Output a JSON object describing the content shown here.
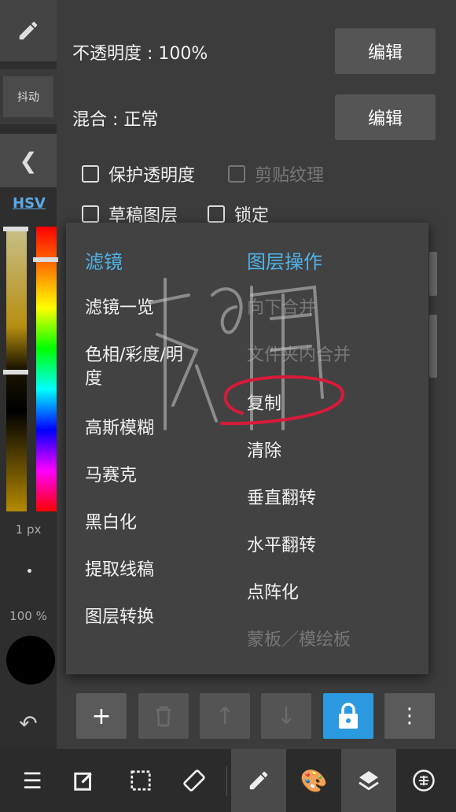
{
  "layer_properties": {
    "opacity_label": "不透明度 : 100%",
    "blend_label": "混合 : 正常",
    "edit_label": "编辑",
    "protect_alpha": "保护透明度",
    "clipping": "剪贴纹理",
    "draft_layer": "草稿图层",
    "lock": "锁定"
  },
  "left_panel": {
    "brush_tab": "抖动",
    "color_mode": "HSV",
    "brush_size": "1 px",
    "brush_opacity": "100 %"
  },
  "menu": {
    "filters_header": "滤镜",
    "filters": [
      "滤镜一览",
      "色相/彩度/明\n度",
      "高斯模糊",
      "马赛克",
      "黑白化",
      "提取线稿",
      "图层转换"
    ],
    "layer_ops_header": "图层操作",
    "layer_ops": [
      {
        "label": "向下合并",
        "enabled": false
      },
      {
        "label": "文件夹内合并",
        "enabled": false
      },
      {
        "label": "复制",
        "enabled": true
      },
      {
        "label": "清除",
        "enabled": true
      },
      {
        "label": "垂直翻转",
        "enabled": true
      },
      {
        "label": "水平翻转",
        "enabled": true
      },
      {
        "label": "点阵化",
        "enabled": true
      },
      {
        "label": "蒙板／模绘板",
        "enabled": false
      }
    ]
  },
  "icons": {
    "add": "plus-icon",
    "delete": "trash-icon",
    "up": "arrow-up-icon",
    "down": "arrow-down-icon",
    "lock": "lock-icon",
    "more": "more-vertical-icon"
  },
  "colors": {
    "accent": "#2b9ae0",
    "header": "#4fb3e8",
    "annotation": "#d81a3a"
  }
}
